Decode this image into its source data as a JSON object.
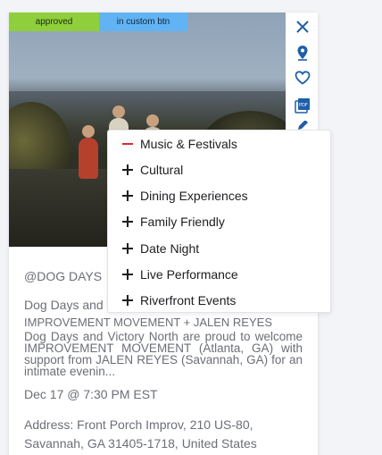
{
  "badges": {
    "approved": "approved",
    "custom": "in custom btn"
  },
  "card": {
    "handle": "@DOG DAYS",
    "title_line1": "Dog Days and Victory North present",
    "title_line2": "IMPROVEMENT MOVEMENT + JALEN REYES",
    "description": "Dog Days and Victory North are proud to welcome IMPROVEMENT MOVEMENT (Atlanta, GA) with support from JALEN REYES (Savannah, GA) for an intimate evenin...",
    "date": "Dec 17 @ 7:30 PM EST",
    "address": "Address: Front Porch Improv, 210 US-80, Savannah, GA 31405-1718, United States"
  },
  "side_icons": [
    "close-icon",
    "map-pin-icon",
    "heart-icon",
    "pdf-icon",
    "edit-icon"
  ],
  "menu": {
    "items": [
      {
        "label": "Music & Festivals",
        "mark": "minus"
      },
      {
        "label": "Cultural",
        "mark": "plus"
      },
      {
        "label": "Dining Experiences",
        "mark": "plus"
      },
      {
        "label": "Family Friendly",
        "mark": "plus"
      },
      {
        "label": "Date Night",
        "mark": "plus"
      },
      {
        "label": "Live Performance",
        "mark": "plus"
      },
      {
        "label": "Riverfront Events",
        "mark": "plus"
      }
    ]
  },
  "colors": {
    "accent_blue": "#1f5fa8",
    "approved": "#8fcf3c",
    "custom": "#62b3f4",
    "minus_red": "#e0262a"
  }
}
